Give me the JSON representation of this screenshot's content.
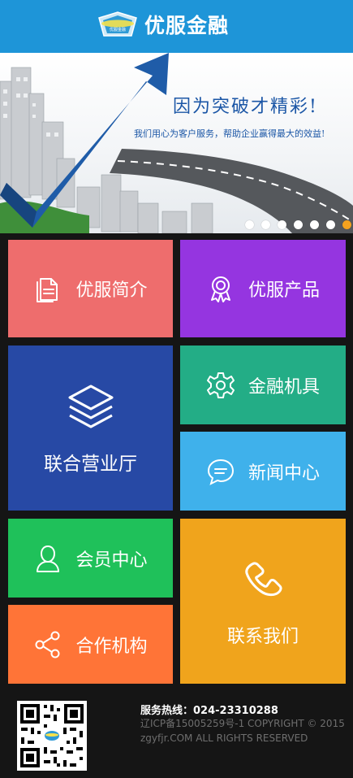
{
  "header": {
    "logo_badge_text": "优服金融",
    "logo_text": "优服金融"
  },
  "banner": {
    "slogan": "因为突破才精彩!",
    "subslogan": "我们用心为客户服务，帮助企业赢得最大的效益!",
    "slide_count": 7,
    "active_slide": 7
  },
  "tiles": {
    "intro": {
      "label": "优服简介",
      "color": "#ee6d6d",
      "icon": "document-icon"
    },
    "products": {
      "label": "优服产品",
      "color": "#9535e0",
      "icon": "award-icon"
    },
    "hall": {
      "label": "联合营业厅",
      "color": "#2749a5",
      "icon": "layers-icon"
    },
    "finance": {
      "label": "金融机具",
      "color": "#23ad86",
      "icon": "gear-icon"
    },
    "news": {
      "label": "新闻中心",
      "color": "#3fb1eb",
      "icon": "chat-icon"
    },
    "member": {
      "label": "会员中心",
      "color": "#1fc15a",
      "icon": "user-icon"
    },
    "partner": {
      "label": "合作机构",
      "color": "#ff7437",
      "icon": "share-icon"
    },
    "contact": {
      "label": "联系我们",
      "color": "#f0a41c",
      "icon": "phone-icon"
    }
  },
  "footer": {
    "hotline": "服务热线：024-23310288",
    "icp": "辽ICP备15005259号-1 COPYRIGHT © 2015",
    "rights": "zgyfjr.COM ALL RIGHTS RESERVED"
  }
}
